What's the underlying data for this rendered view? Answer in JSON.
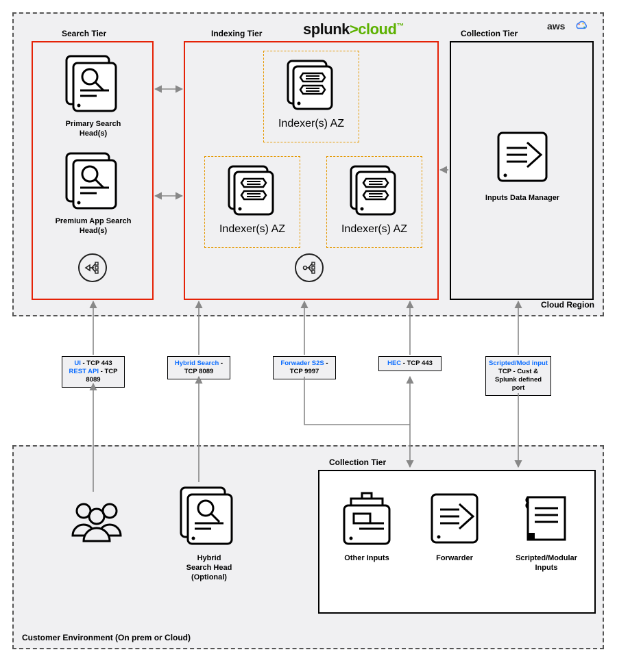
{
  "logos": {
    "splunk_pre": "splunk",
    "splunk_gt": ">",
    "splunk_cloud": "cloud",
    "aws": "aws"
  },
  "labels": {
    "cloud_region": "Cloud Region",
    "customer_env": "Customer Environment (On prem or Cloud)",
    "search_tier": "Search Tier",
    "indexing_tier": "Indexing Tier",
    "collection_tier_cloud": "Collection Tier",
    "collection_tier_cust": "Collection Tier"
  },
  "components": {
    "primary_sh": "Primary Search Head(s)",
    "premium_sh": "Premium App Search Head(s)",
    "indexer_az": "Indexer(s) AZ",
    "idm": "Inputs Data Manager",
    "hybrid_sh_l1": "Hybrid",
    "hybrid_sh_l2": "Search Head",
    "hybrid_sh_l3": "(Optional)",
    "other_inputs": "Other Inputs",
    "forwarder": "Forwarder",
    "scripted_inputs": "Scripted/Modular Inputs"
  },
  "protocols": {
    "p1_ui": "UI",
    "p1_ui_port": " - TCP 443",
    "p1_rest": "REST API",
    "p1_rest_port": " - TCP 8089",
    "p2_name": "Hybrid Search",
    "p2_port": " - TCP 8089",
    "p3_name": "Forwader S2S",
    "p3_port": " - TCP 9997",
    "p4_name": "HEC",
    "p4_port": " - TCP 443",
    "p5_name": "Scripted/Mod input",
    "p5_port": "TCP - Cust & Splunk defined port"
  }
}
